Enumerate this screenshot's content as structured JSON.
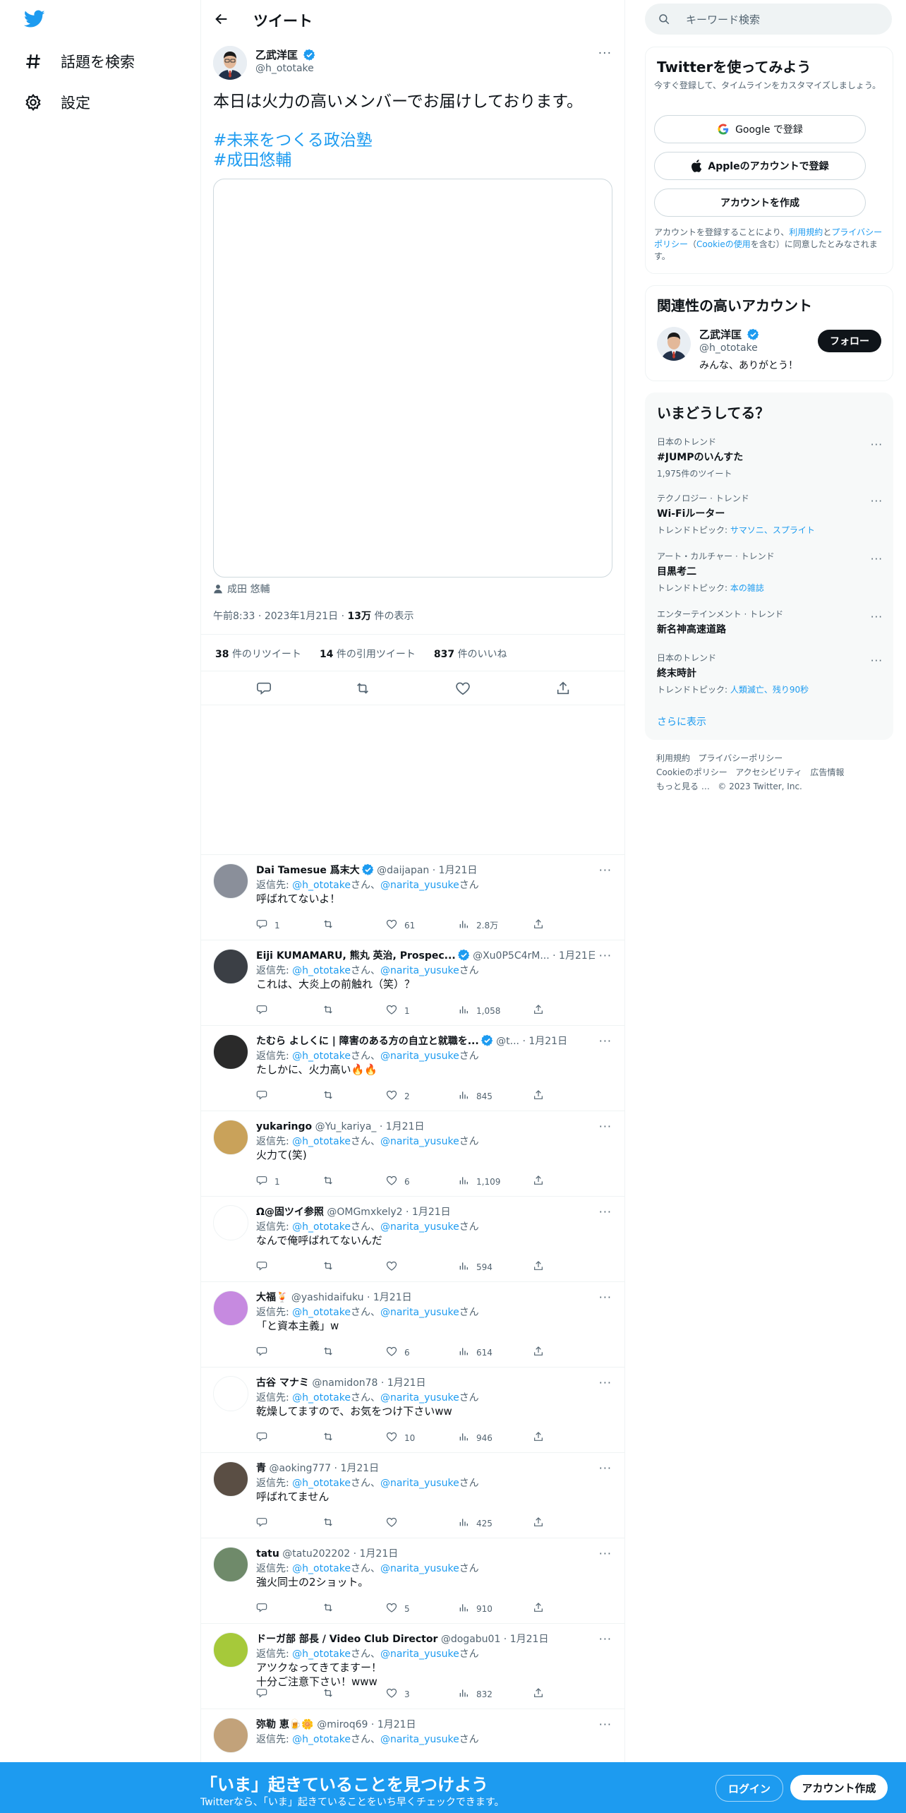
{
  "nav": {
    "items": [
      {
        "label": "話題を検索",
        "icon": "hashtag-icon"
      },
      {
        "label": "設定",
        "icon": "gear-icon"
      }
    ]
  },
  "header": {
    "title": "ツイート"
  },
  "tweet": {
    "author_name": "乙武洋匡",
    "author_handle": "@h_ototake",
    "text": "本日は火力の高いメンバーでお届けしております。",
    "hashtags": [
      "#未来をつくる政治塾",
      "#成田悠輔"
    ],
    "tagged_person": "成田 悠輔",
    "time": "午前8:33",
    "date": "2023年1月21日",
    "views_count": "13万",
    "views_label": "件の表示",
    "stats": [
      {
        "count": "38",
        "label": "件のリツイート"
      },
      {
        "count": "14",
        "label": "件の引用ツイート"
      },
      {
        "count": "837",
        "label": "件のいいね"
      }
    ]
  },
  "replies": [
    {
      "name": "Dai Tamesue 爲末大",
      "verified": true,
      "handle": "@daijapan",
      "date": "1月21日",
      "to_prefix": "返信先: ",
      "to1": "@h_ototake",
      "to_mid": "さん、",
      "to2": "@narita_yusuke",
      "to_suffix": "さん",
      "text": "呼ばれてないよ！",
      "replies": "1",
      "retweets": "",
      "likes": "61",
      "views": "2.8万",
      "avatar_color": "#8a8f9a"
    },
    {
      "name": "Eiji KUMAMARU, 熊丸 英治, Prospec...",
      "verified": true,
      "handle": "@Xu0P5C4rM...",
      "date": "1月21日",
      "to_prefix": "返信先: ",
      "to1": "@h_ototake",
      "to_mid": "さん、",
      "to2": "@narita_yusuke",
      "to_suffix": "さん",
      "text": "これは、大炎上の前触れ（笑）？",
      "replies": "",
      "retweets": "",
      "likes": "1",
      "views": "1,058",
      "avatar_color": "#3b3f45"
    },
    {
      "name": "たむら よしくに | 障害のある方の自立と就職を...",
      "verified": true,
      "handle": "@t...",
      "date": "1月21日",
      "to_prefix": "返信先: ",
      "to1": "@h_ototake",
      "to_mid": "さん、",
      "to2": "@narita_yusuke",
      "to_suffix": "さん",
      "text": "たしかに、火力高い🔥🔥",
      "replies": "",
      "retweets": "",
      "likes": "2",
      "views": "845",
      "avatar_color": "#2a2a2a"
    },
    {
      "name": "yukaringo",
      "verified": false,
      "handle": "@Yu_kariya_",
      "date": "1月21日",
      "to_prefix": "返信先: ",
      "to1": "@h_ototake",
      "to_mid": "さん、",
      "to2": "@narita_yusuke",
      "to_suffix": "さん",
      "text": "火力て(笑)",
      "replies": "1",
      "retweets": "",
      "likes": "6",
      "views": "1,109",
      "avatar_color": "#c9a25a"
    },
    {
      "name": "Ω@固ツイ参照",
      "verified": false,
      "handle": "@OMGmxkely2",
      "date": "1月21日",
      "to_prefix": "返信先: ",
      "to1": "@h_ototake",
      "to_mid": "さん、",
      "to2": "@narita_yusuke",
      "to_suffix": "さん",
      "text": "なんで俺呼ばれてないんだ",
      "replies": "",
      "retweets": "",
      "likes": "",
      "views": "594",
      "avatar_color": "#ffffff"
    },
    {
      "name": "大福🍹",
      "verified": false,
      "handle": "@yashidaifuku",
      "date": "1月21日",
      "to_prefix": "返信先: ",
      "to1": "@h_ototake",
      "to_mid": "さん、",
      "to2": "@narita_yusuke",
      "to_suffix": "さん",
      "text": "「と資本主義」w",
      "replies": "",
      "retweets": "",
      "likes": "6",
      "views": "614",
      "avatar_color": "#c68ae0"
    },
    {
      "name": "古谷 マナミ",
      "verified": false,
      "handle": "@namidon78",
      "date": "1月21日",
      "to_prefix": "返信先: ",
      "to1": "@h_ototake",
      "to_mid": "さん、",
      "to2": "@narita_yusuke",
      "to_suffix": "さん",
      "text": "乾燥してますので、お気をつけ下さいww",
      "replies": "",
      "retweets": "",
      "likes": "10",
      "views": "946",
      "avatar_color": "#ffffff"
    },
    {
      "name": "青",
      "verified": false,
      "handle": "@aoking777",
      "date": "1月21日",
      "to_prefix": "返信先: ",
      "to1": "@h_ototake",
      "to_mid": "さん、",
      "to2": "@narita_yusuke",
      "to_suffix": "さん",
      "text": "呼ばれてません",
      "replies": "",
      "retweets": "",
      "likes": "",
      "views": "425",
      "avatar_color": "#5a4e44"
    },
    {
      "name": "tatu",
      "verified": false,
      "handle": "@tatu202202",
      "date": "1月21日",
      "to_prefix": "返信先: ",
      "to1": "@h_ototake",
      "to_mid": "さん、",
      "to2": "@narita_yusuke",
      "to_suffix": "さん",
      "text": "強火同士の2ショット。",
      "replies": "",
      "retweets": "",
      "likes": "5",
      "views": "910",
      "avatar_color": "#6f8a6a"
    },
    {
      "name": "ドーガ部 部長 / Video Club Director",
      "verified": false,
      "handle": "@dogabu01",
      "date": "1月21日",
      "to_prefix": "返信先: ",
      "to1": "@h_ototake",
      "to_mid": "さん、",
      "to2": "@narita_yusuke",
      "to_suffix": "さん",
      "text": "アツクなってきてますー！\n十分ご注意下さい！www",
      "replies": "",
      "retweets": "",
      "likes": "3",
      "views": "832",
      "avatar_color": "#a6c93a"
    },
    {
      "name": "弥勒 恵🍺🌼",
      "verified": false,
      "handle": "@miroq69",
      "date": "1月21日",
      "to_prefix": "返信先: ",
      "to1": "@h_ototake",
      "to_mid": "さん、",
      "to2": "@narita_yusuke",
      "to_suffix": "さん",
      "text": "",
      "replies": "",
      "retweets": "",
      "likes": "",
      "views": "",
      "avatar_color": "#c2a27a"
    }
  ],
  "search": {
    "placeholder": "キーワード検索"
  },
  "signup": {
    "title": "Twitterを使ってみよう",
    "subtitle": "今すぐ登録して、タイムラインをカスタマイズしましょう。",
    "google_label": "Google で登録",
    "apple_label": "Appleのアカウントで登録",
    "create_label": "アカウントを作成",
    "legal_1": "アカウントを登録することにより、",
    "legal_terms": "利用規約",
    "legal_2": "と",
    "legal_privacy": "プライバシーポリシー",
    "legal_3": "（",
    "legal_cookie": "Cookieの使用",
    "legal_4": "を含む）に同意したとみなされます。"
  },
  "related": {
    "title": "関連性の高いアカウント",
    "name": "乙武洋匡",
    "handle": "@h_ototake",
    "bio": "みんな、ありがとう！",
    "follow_label": "フォロー"
  },
  "trends": {
    "title": "いまどうしてる？",
    "items": [
      {
        "category": "日本のトレンド",
        "name": "#JUMPのいんすた",
        "extra": "1,975件のツイート",
        "topics_label": "",
        "topics": ""
      },
      {
        "category": "テクノロジー · トレンド",
        "name": "Wi-Fiルーター",
        "extra": "",
        "topics_label": "トレンドトピック: ",
        "topics": "サマソニ、スプライト"
      },
      {
        "category": "アート・カルチャー · トレンド",
        "name": "目黒考二",
        "extra": "",
        "topics_label": "トレンドトピック: ",
        "topics": "本の雑誌"
      },
      {
        "category": "エンターテインメント · トレンド",
        "name": "新名神高速道路",
        "extra": "",
        "topics_label": "",
        "topics": ""
      },
      {
        "category": "日本のトレンド",
        "name": "終末時計",
        "extra": "",
        "topics_label": "トレンドトピック: ",
        "topics": "人類滅亡、残り90秒"
      }
    ],
    "show_more": "さらに表示"
  },
  "footer": {
    "line1": [
      "利用規約",
      "プライバシーポリシー"
    ],
    "line2": [
      "Cookieのポリシー",
      "アクセシビリティ",
      "広告情報"
    ],
    "more": "もっと見る …",
    "copyright": "© 2023 Twitter, Inc."
  },
  "bottombar": {
    "title": "「いま」起きていることを見つけよう",
    "subtitle": "Twitterなら、「いま」起きていることをいち早くチェックできます。",
    "login_label": "ログイン",
    "signup_label": "アカウント作成"
  },
  "colors": {
    "accent": "#1d9bf0",
    "text": "#0f1419",
    "muted": "#536471",
    "border": "#eff3f4"
  }
}
